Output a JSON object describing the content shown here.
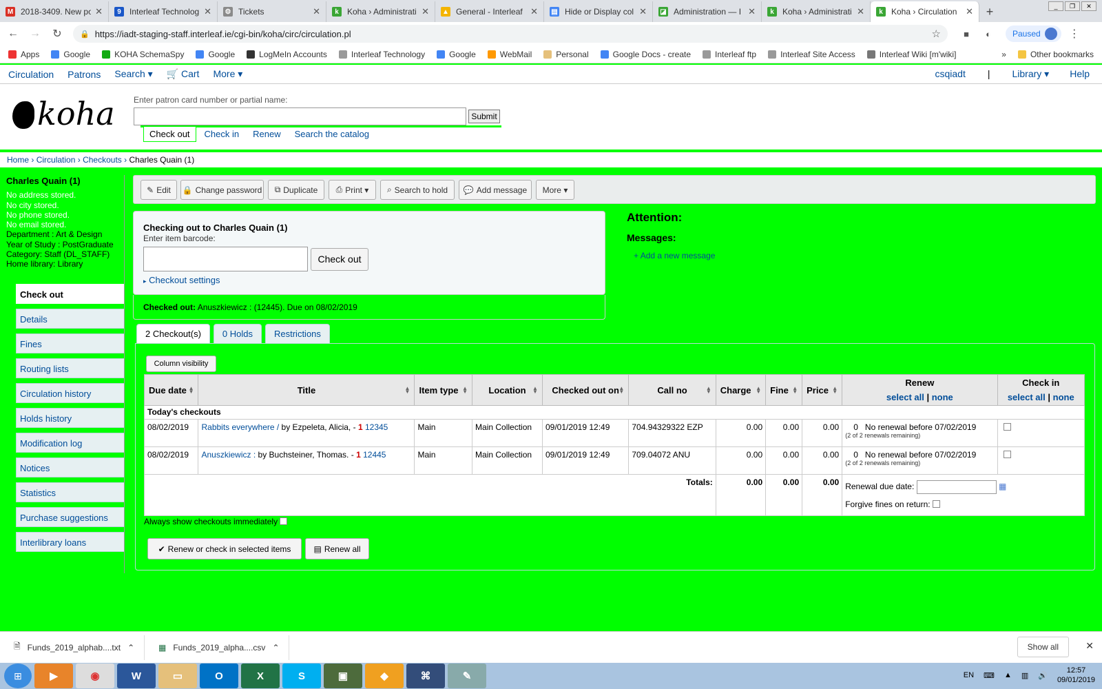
{
  "browser": {
    "tabs": [
      {
        "title": "2018-3409. New po",
        "color": "#d93025",
        "glyph": "M"
      },
      {
        "title": "Interleaf Technolog",
        "color": "#1a57c8",
        "glyph": "9"
      },
      {
        "title": "Tickets",
        "color": "#8a8a8a",
        "glyph": "⚙"
      },
      {
        "title": "Koha › Administrati",
        "color": "#3aa635",
        "glyph": "k"
      },
      {
        "title": "General - Interleaf",
        "color": "#f4b400",
        "glyph": "▲"
      },
      {
        "title": "Hide or Display col",
        "color": "#4285f4",
        "glyph": "▤"
      },
      {
        "title": "Administration — I",
        "color": "#3aa635",
        "glyph": "◪"
      },
      {
        "title": "Koha › Administrati",
        "color": "#3aa635",
        "glyph": "k"
      },
      {
        "title": "Koha › Circulation",
        "color": "#3aa635",
        "glyph": "k"
      }
    ],
    "url": "https://iadt-staging-staff.interleaf.ie/cgi-bin/koha/circ/circulation.pl",
    "paused": "Paused",
    "bookmarks": [
      "Apps",
      "Google",
      "KOHA SchemaSpy",
      "Google",
      "LogMeIn Accounts",
      "Interleaf Technology",
      "Google",
      "WebMail",
      "Personal",
      "Google Docs - create",
      "Interleaf ftp",
      "Interleaf Site Access",
      "Interleaf Wiki [m'wiki]"
    ],
    "other_bookmarks": "Other bookmarks",
    "more_bookmarks": "»"
  },
  "koha_nav": {
    "left": [
      "Circulation",
      "Patrons",
      "Search ▾",
      "🛒 Cart",
      "More ▾"
    ],
    "user": "csqiadt",
    "library": "Library ▾",
    "help": "Help"
  },
  "header": {
    "logo": "koha",
    "patron_label": "Enter patron card number or partial name:",
    "submit": "Submit",
    "tabs": [
      "Check out",
      "Check in",
      "Renew",
      "Search the catalog"
    ]
  },
  "breadcrumb": {
    "links": [
      "Home",
      "Circulation",
      "Checkouts"
    ],
    "current": "Charles Quain (1)",
    "sep": "›"
  },
  "patron": {
    "name": "Charles Quain (1)",
    "warnings": [
      "No address stored.",
      "No city stored.",
      "No phone stored.",
      "No email stored."
    ],
    "details": [
      "Department : Art & Design",
      "Year of Study : PostGraduate",
      "Category: Staff (DL_STAFF)",
      "Home library: Library"
    ]
  },
  "left_nav": [
    "Check out",
    "Details",
    "Fines",
    "Routing lists",
    "Circulation history",
    "Holds history",
    "Modification log",
    "Notices",
    "Statistics",
    "Purchase suggestions",
    "Interlibrary loans"
  ],
  "toolbar": {
    "edit": "Edit",
    "change_password": "Change password",
    "duplicate": "Duplicate",
    "print": "Print ▾",
    "search_to_hold": "Search to hold",
    "add_message": "Add message",
    "more": "More ▾"
  },
  "checkout": {
    "heading": "Checking out to Charles Quain (1)",
    "barcode_label": "Enter item barcode:",
    "button": "Check out",
    "settings": "Checkout settings",
    "checked_out_label": "Checked out:",
    "checked_out_text": "Anuszkiewicz : (12445). Due on 08/02/2019"
  },
  "attention": {
    "title": "Attention:",
    "messages": "Messages:",
    "add_message": "Add a new message"
  },
  "tabs": [
    "2 Checkout(s)",
    "0 Holds",
    "Restrictions"
  ],
  "table": {
    "column_visibility": "Column visibility",
    "headers": [
      "Due date",
      "Title",
      "Item type",
      "Location",
      "Checked out on",
      "Call no",
      "Charge",
      "Fine",
      "Price",
      "Renew",
      "Check in"
    ],
    "select_all": "select all",
    "none": "none",
    "group": "Today's checkouts",
    "rows": [
      {
        "due": "08/02/2019",
        "title": "Rabbits everywhere /",
        "by": "by Ezpeleta, Alicia, -",
        "copies": "1",
        "barcode": "12345",
        "type": "Main",
        "location": "Main Collection",
        "out_on": "09/01/2019 12:49",
        "callno": "704.94329322 EZP",
        "charge": "0.00",
        "fine": "0.00",
        "price": "0.00",
        "renew_count": "0",
        "renew_note": "No renewal before 07/02/2019",
        "renew_remaining": "(2 of 2 renewals remaining)"
      },
      {
        "due": "08/02/2019",
        "title": "Anuszkiewicz :",
        "by": "by Buchsteiner, Thomas. -",
        "copies": "1",
        "barcode": "12445",
        "type": "Main",
        "location": "Main Collection",
        "out_on": "09/01/2019 12:49",
        "callno": "709.04072 ANU",
        "charge": "0.00",
        "fine": "0.00",
        "price": "0.00",
        "renew_count": "0",
        "renew_note": "No renewal before 07/02/2019",
        "renew_remaining": "(2 of 2 renewals remaining)"
      }
    ],
    "totals_label": "Totals:",
    "totals": {
      "charge": "0.00",
      "fine": "0.00",
      "price": "0.00"
    },
    "renewal_due_date": "Renewal due date:",
    "forgive_fines": "Forgive fines on return:"
  },
  "always_show": "Always show checkouts immediately",
  "buttons": {
    "renew_or_checkin": "Renew or check in selected items",
    "renew_all": "Renew all"
  },
  "downloads": {
    "items": [
      "Funds_2019_alphab....txt",
      "Funds_2019_alpha....csv"
    ],
    "show_all": "Show all"
  },
  "taskbar": {
    "lang": "EN",
    "time": "12:57",
    "date": "09/01/2019"
  }
}
